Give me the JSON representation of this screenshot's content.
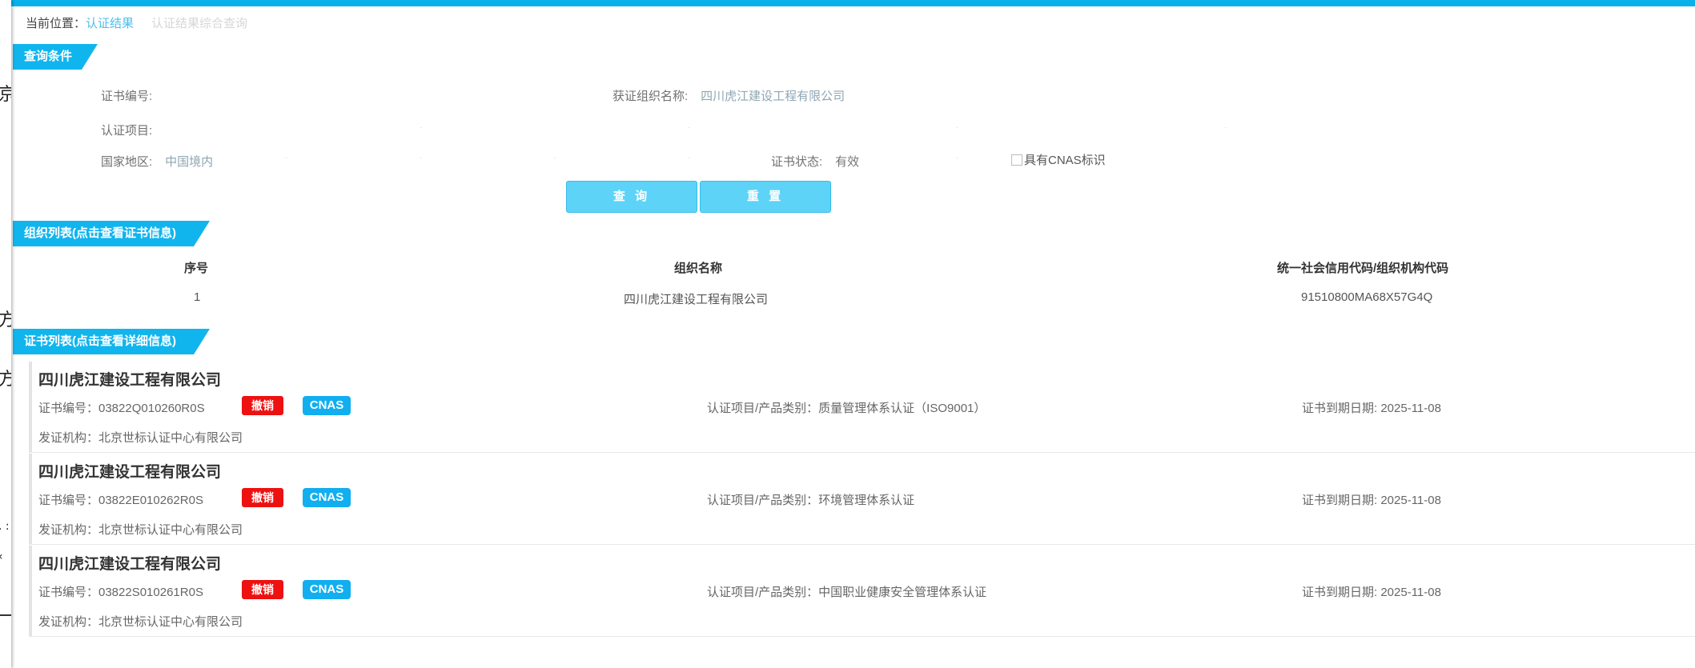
{
  "breadcrumb": {
    "prefix": "当前位置：",
    "current": "认证结果",
    "faint": "认证结果综合查询"
  },
  "left_strip_glyphs": [
    "京",
    "方",
    "方",
    ". :",
    "‹"
  ],
  "sections": {
    "query": "查询条件",
    "org_list": "组织列表(点击查看证书信息)",
    "cert_list": "证书列表(点击查看详细信息)"
  },
  "query": {
    "cert_no_label": "证书编号:",
    "org_name_label": "获证组织名称:",
    "org_name_value": "四川虎江建设工程有限公司",
    "project_label": "认证项目:",
    "region_label": "国家地区:",
    "region_value": "中国境内",
    "status_label": "证书状态:",
    "status_value": "有效",
    "cnas_checkbox_label": "具有CNAS标识",
    "query_button": "查 询",
    "reset_button": "重 置"
  },
  "org_table": {
    "headers": [
      "序号",
      "组织名称",
      "统一社会信用代码/组织机构代码"
    ],
    "rows": [
      {
        "seq": "1",
        "name": "四川虎江建设工程有限公司",
        "code": "91510800MA68X57G4Q"
      }
    ]
  },
  "cert_cards": [
    {
      "org": "四川虎江建设工程有限公司",
      "cert_no": "证书编号：03822Q010260R0S",
      "badge_status": "撤销",
      "badge_cnas": "CNAS",
      "project": "认证项目/产品类别：质量管理体系认证（ISO9001）",
      "expire": "证书到期日期: 2025-11-08",
      "issuer": "发证机构：北京世标认证中心有限公司"
    },
    {
      "org": "四川虎江建设工程有限公司",
      "cert_no": "证书编号：03822E010262R0S",
      "badge_status": "撤销",
      "badge_cnas": "CNAS",
      "project": "认证项目/产品类别：环境管理体系认证",
      "expire": "证书到期日期: 2025-11-08",
      "issuer": "发证机构：北京世标认证中心有限公司"
    },
    {
      "org": "四川虎江建设工程有限公司",
      "cert_no": "证书编号：03822S010261R0S",
      "badge_status": "撤销",
      "badge_cnas": "CNAS",
      "project": "认证项目/产品类别：中国职业健康安全管理体系认证",
      "expire": "证书到期日期: 2025-11-08",
      "issuer": "发证机构：北京世标认证中心有限公司"
    }
  ],
  "colors": {
    "accent": "#11b5ee",
    "button": "#5dd3f7",
    "revoked_badge": "#ee1111",
    "cnas_badge": "#11aef0"
  }
}
